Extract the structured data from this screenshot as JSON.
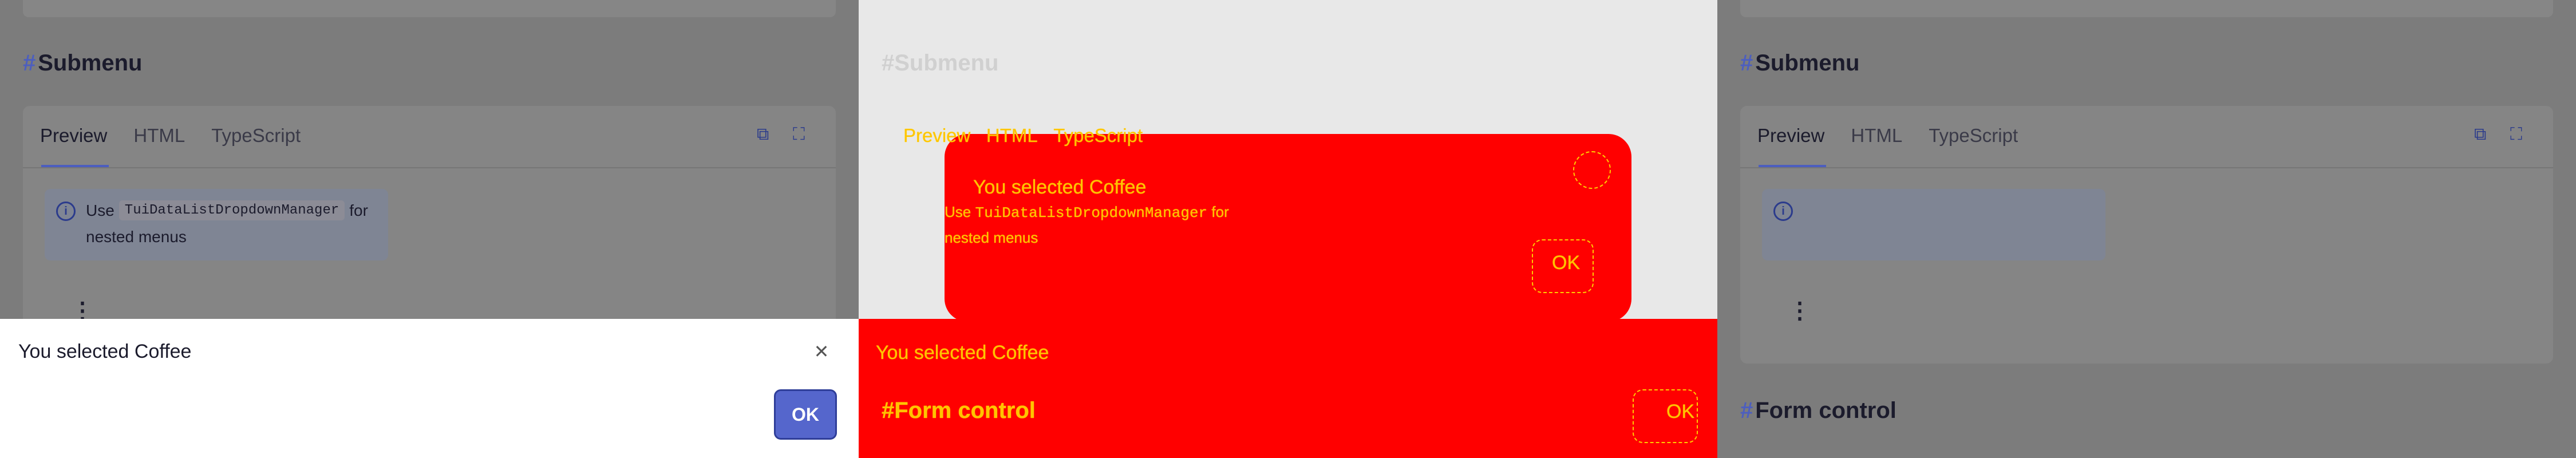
{
  "docs": {
    "section_title": "Submenu",
    "hash": "#",
    "tabs": [
      "Preview",
      "HTML",
      "TypeScript"
    ],
    "note_prefix": "Use",
    "note_code": "TuiDataListDropdownManager",
    "note_suffix": "for",
    "note_line2": "nested menus",
    "info_icon": "info-icon",
    "kebab_icon": "more-vertical-icon",
    "next_section_title": "Form control"
  },
  "dialog": {
    "message": "You selected Coffee",
    "ok_label": "OK",
    "close_icon": "close-icon"
  },
  "colors": {
    "accent": "#5566cc",
    "diff_red": "#ff0000",
    "diff_outline": "#ffcc00"
  }
}
